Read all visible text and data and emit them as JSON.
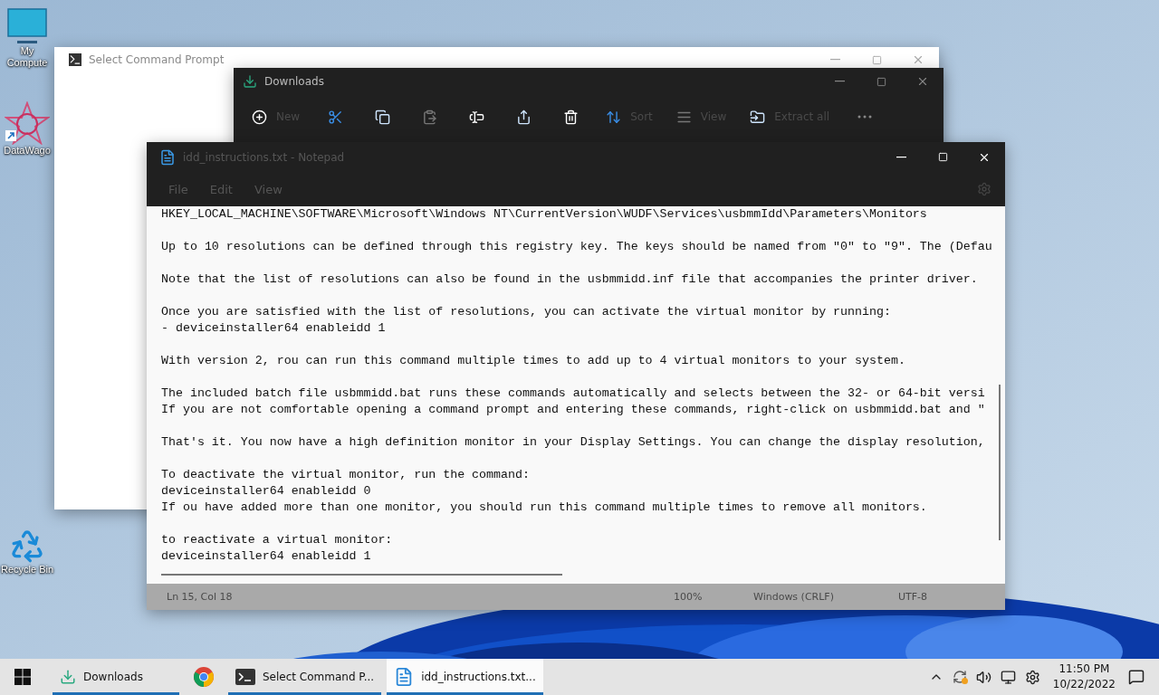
{
  "desktop_icons": [
    {
      "kind": "computer",
      "label": "My Compute"
    },
    {
      "kind": "shortcut",
      "label": "DataWago"
    },
    {
      "kind": "recycle",
      "label": "Recycle Bin"
    }
  ],
  "command_prompt_window": {
    "title": "Select Command Prompt"
  },
  "downloads_window": {
    "title": "Downloads",
    "toolbar": [
      {
        "kind": "new",
        "label": "New"
      },
      {
        "kind": "cut"
      },
      {
        "kind": "copy"
      },
      {
        "kind": "paste"
      },
      {
        "kind": "rename"
      },
      {
        "kind": "share"
      },
      {
        "kind": "delete"
      },
      {
        "kind": "sort",
        "label": "Sort"
      },
      {
        "kind": "view",
        "label": "View"
      },
      {
        "kind": "extract",
        "label": "Extract all"
      },
      {
        "kind": "more"
      }
    ]
  },
  "notepad_window": {
    "title": "idd_instructions.txt - Notepad",
    "menu": [
      "File",
      "Edit",
      "View"
    ],
    "paragraphs": [
      [
        "HKEY_LOCAL_MACHINE\\SOFTWARE\\Microsoft\\Windows NT\\CurrentVersion\\WUDF\\Services\\usbmmIdd\\Parameters\\Monitors"
      ],
      [
        "Up to 10 resolutions can be defined through this registry key. The keys should be named from \"0\" to \"9\". The (Defau"
      ],
      [
        "Note that the list of resolutions can also be found in the usbmmidd.inf file that accompanies the printer driver."
      ],
      [
        "Once you are satisfied with the list of resolutions, you can activate the virtual monitor by running:",
        "- deviceinstaller64 enableidd 1"
      ],
      [
        "With version 2, rou can run this command multiple times to add up to 4 virtual monitors to your system."
      ],
      [
        "The included batch file usbmmidd.bat runs these commands automatically and selects between the 32- or 64-bit versi",
        "If you are not comfortable opening a command prompt and entering these commands, right-click on usbmmidd.bat and \""
      ],
      [
        "That's it. You now have a high definition monitor in your Display Settings. You can change the display resolution,"
      ],
      [
        "To deactivate the virtual monitor, run the command:",
        "deviceinstaller64 enableidd 0",
        "If ou have added more than one monitor, you should run this command multiple times to remove all monitors."
      ],
      [
        "to reactivate a virtual monitor:",
        "deviceinstaller64 enableidd 1"
      ]
    ],
    "status_bar": {
      "position": "Ln 15, Col 18",
      "zoom": "100%",
      "line_endings": "Windows (CRLF)",
      "encoding": "UTF-8"
    }
  },
  "taskbar": {
    "items": [
      {
        "kind": "download",
        "label": "Downloads",
        "open": true,
        "selected": false
      },
      {
        "kind": "chrome",
        "open": false,
        "selected": false
      },
      {
        "kind": "terminal",
        "label": "Select Command P...",
        "open": true,
        "selected": false
      },
      {
        "kind": "notepad",
        "label": "idd_instructions.txt...",
        "open": true,
        "selected": true
      }
    ],
    "time": "11:50 PM",
    "date": "10/22/2022"
  }
}
